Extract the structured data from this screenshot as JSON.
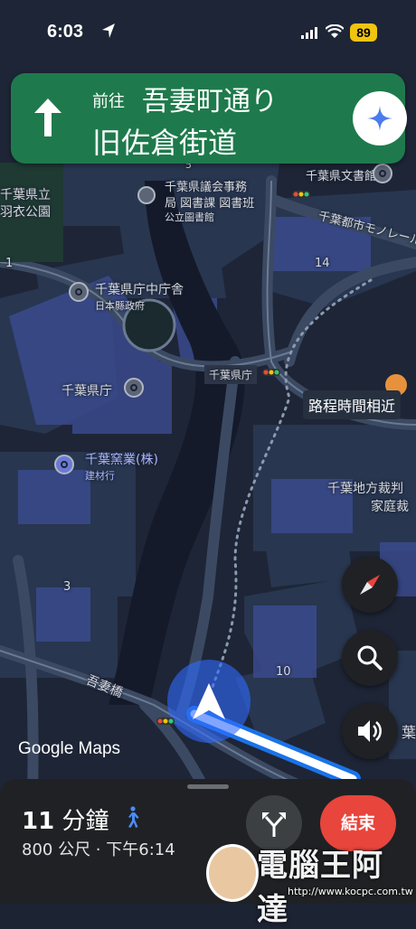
{
  "status_bar": {
    "time": "6:03",
    "battery": "89"
  },
  "banner": {
    "prefix": "前往",
    "street": "吾妻町通り",
    "road": "旧佐倉街道"
  },
  "map_labels": {
    "chiba_pref_park_1": "千葉県立",
    "chiba_pref_park_2": "羽衣公園",
    "library_1": "千葉県議会事務",
    "library_2": "局 図書課 図書班",
    "library_3": "公立圖書館",
    "bunka": "千葉県文書館",
    "monorail": "千葉都市モノレール",
    "chuo_1": "千葉県庁中庁舎",
    "chuo_2": "日本縣政府",
    "kencho": "千葉県庁",
    "kencho_station": "千葉県庁",
    "kiln_1": "千葉窯業(株)",
    "kiln_2": "建材行",
    "court_1": "千葉地方裁判",
    "court_2": "家庭裁",
    "bridge": "吾妻橋",
    "num_1": "1",
    "num_14": "14",
    "num_3": "3",
    "num_10": "10",
    "num_5": "5",
    "google_maps": "Google Maps",
    "route_time": "路程時間相近",
    "edge_text": "葉"
  },
  "bottom_sheet": {
    "eta_num": "11",
    "eta_unit": "分鐘",
    "distance": "800 公尺 · 下午6:14",
    "end_label": "結束"
  },
  "watermark": {
    "title": "電腦王阿達",
    "url": "http://www.kocpc.com.tw"
  },
  "icons": [
    "navigation-arrow-icon",
    "straight-arrow-icon",
    "gemini-sparkle-icon",
    "compass-icon",
    "search-icon",
    "sound-icon",
    "walk-icon",
    "alt-routes-icon",
    "wifi-icon",
    "signal-icon",
    "location-icon"
  ],
  "colors": {
    "banner": "#1e7a4c",
    "end_button": "#e8453c",
    "map_bg": "#1c2333",
    "route": "#1a73e8"
  }
}
